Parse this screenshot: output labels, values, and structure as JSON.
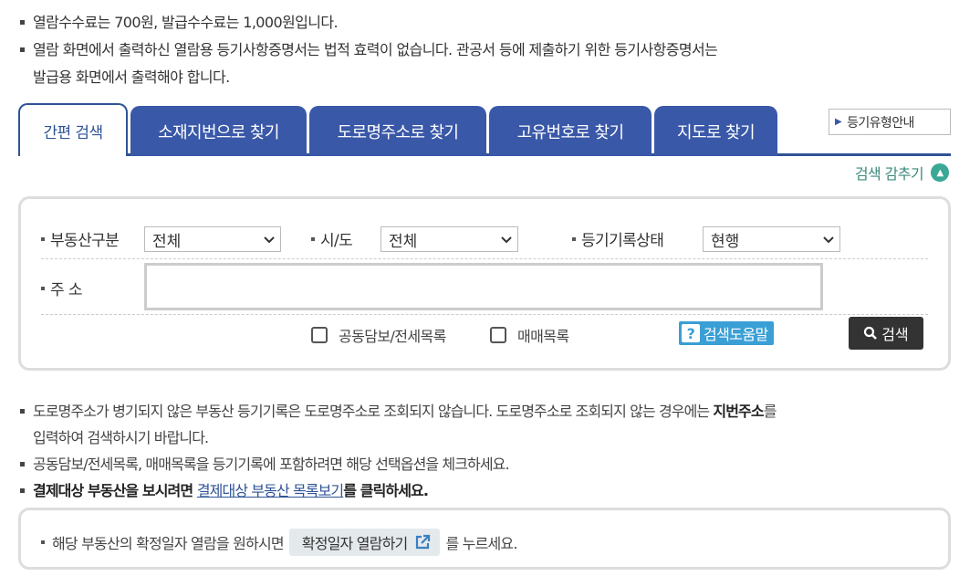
{
  "notices_top": [
    "열람수수료는 700원, 발급수수료는 1,000원입니다.",
    "열람 화면에서 출력하신 열람용 등기사항증명서는 법적 효력이 없습니다. 관공서 등에 제출하기 위한 등기사항증명서는",
    "발급용 화면에서 출력해야 합니다."
  ],
  "tabs": [
    {
      "label": "간편 검색"
    },
    {
      "label": "소재지번으로 찾기"
    },
    {
      "label": "도로명주소로 찾기"
    },
    {
      "label": "고유번호로 찾기"
    },
    {
      "label": "지도로 찾기"
    }
  ],
  "guide_button": "등기유형안내",
  "hide_search": "검색 감추기",
  "search": {
    "property_type_label": "부동산구분",
    "property_type_value": "전체",
    "city_label": "시/도",
    "city_value": "전체",
    "record_status_label": "등기기록상태",
    "record_status_value": "현행",
    "address_label": "주 소",
    "address_value": "",
    "check_joint": "공동담보/전세목록",
    "check_sale": "매매목록",
    "help_button": "검색도움말",
    "search_button": "검색"
  },
  "notices_bottom": {
    "line1a": "도로명주소가 병기되지 않은 부동산 등기기록은 도로명주소로 조회되지 않습니다. 도로명주소로 조회되지 않는 경우에는 ",
    "line1_strong": "지번주소",
    "line1b": "를",
    "line1c": "입력하여 검색하시기 바랍니다.",
    "line2": "공동담보/전세목록, 매매목록을 등기기록에 포함하려면 해당 선택옵션을 체크하세요.",
    "line3a": "결제대상 부동산을 보시려면 ",
    "line3_link": "결제대상 부동산 목록보기",
    "line3b": "를 클릭하세요."
  },
  "confirm": {
    "before": "해당 부동산의 확정일자 열람을 원하시면",
    "button": "확정일자 열람하기",
    "after": "를 누르세요."
  },
  "colors": {
    "tab_bg": "#3a58a8",
    "tab_active_border": "#2f5496",
    "hide_link": "#3a8a7a",
    "help_button": "#3a9fd5",
    "search_button": "#333333"
  }
}
